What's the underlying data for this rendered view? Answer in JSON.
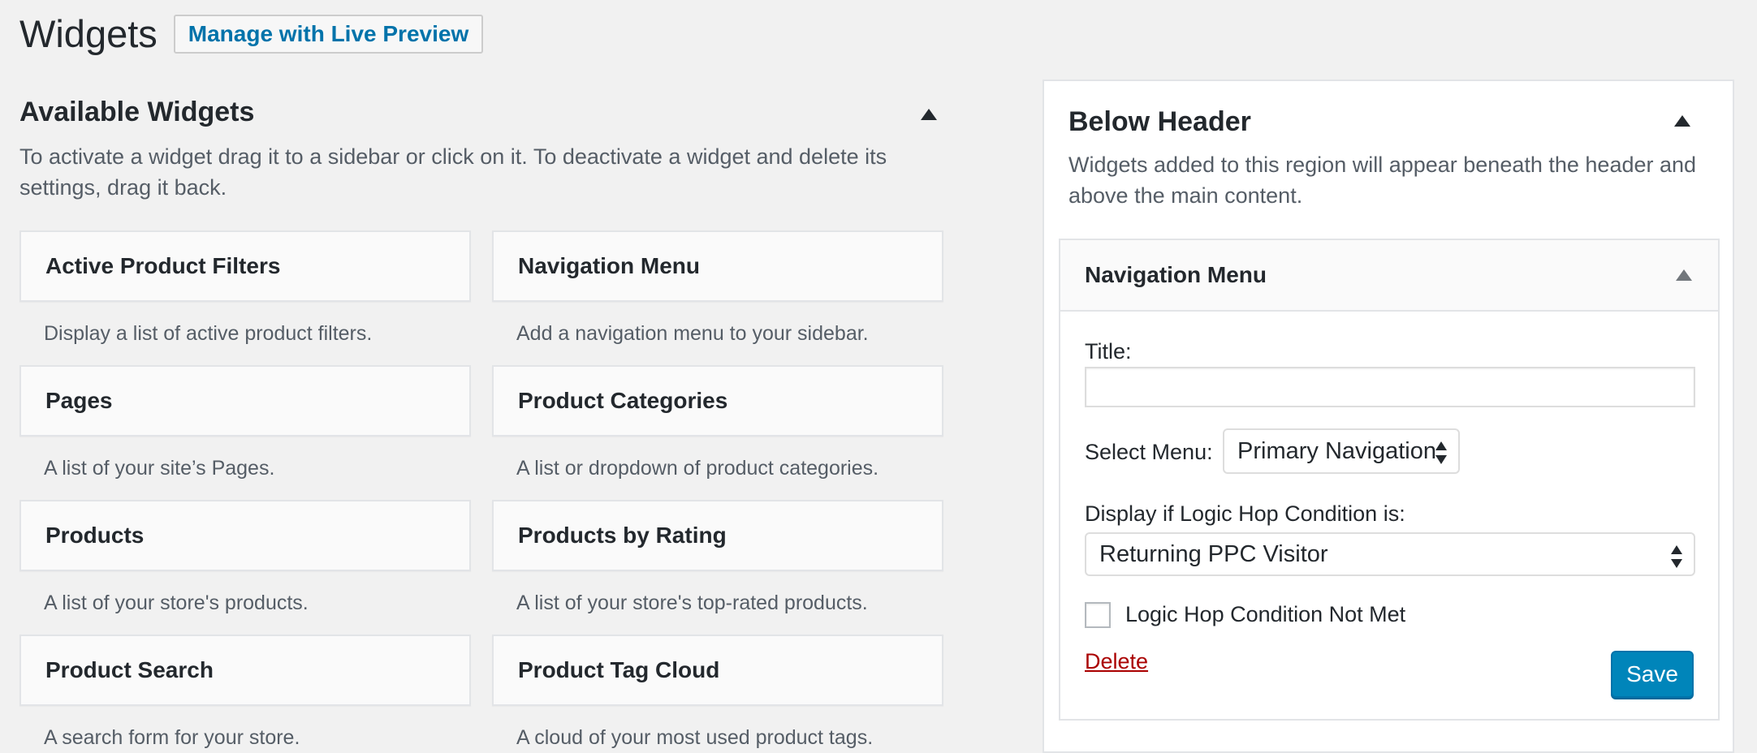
{
  "header": {
    "title": "Widgets",
    "live_preview_label": "Manage with Live Preview"
  },
  "available": {
    "title": "Available Widgets",
    "description": "To activate a widget drag it to a sidebar or click on it. To deactivate a widget and delete its settings, drag it back.",
    "widgets": [
      {
        "title": "Active Product Filters",
        "description": "Display a list of active product filters."
      },
      {
        "title": "Navigation Menu",
        "description": "Add a navigation menu to your sidebar."
      },
      {
        "title": "Pages",
        "description": "A list of your site’s Pages."
      },
      {
        "title": "Product Categories",
        "description": "A list or dropdown of product categories."
      },
      {
        "title": "Products",
        "description": "A list of your store's products."
      },
      {
        "title": "Products by Rating",
        "description": "A list of your store's top-rated products."
      },
      {
        "title": "Product Search",
        "description": "A search form for your store."
      },
      {
        "title": "Product Tag Cloud",
        "description": "A cloud of your most used product tags."
      }
    ]
  },
  "sidebar": {
    "title": "Below Header",
    "description": "Widgets added to this region will appear beneath the header and above the main content.",
    "widget": {
      "title": "Navigation Menu",
      "title_label": "Title:",
      "title_value": "",
      "select_menu_label": "Select Menu:",
      "select_menu_value": "Primary Navigation",
      "condition_label": "Display if Logic Hop Condition is:",
      "condition_value": "Returning PPC Visitor",
      "not_met_label": "Logic Hop Condition Not Met",
      "not_met_checked": false,
      "delete_label": "Delete",
      "save_label": "Save"
    }
  },
  "colors": {
    "background": "#f1f1f1",
    "link_blue": "#0073aa",
    "primary_button": "#0085ba",
    "delete_red": "#a00"
  }
}
